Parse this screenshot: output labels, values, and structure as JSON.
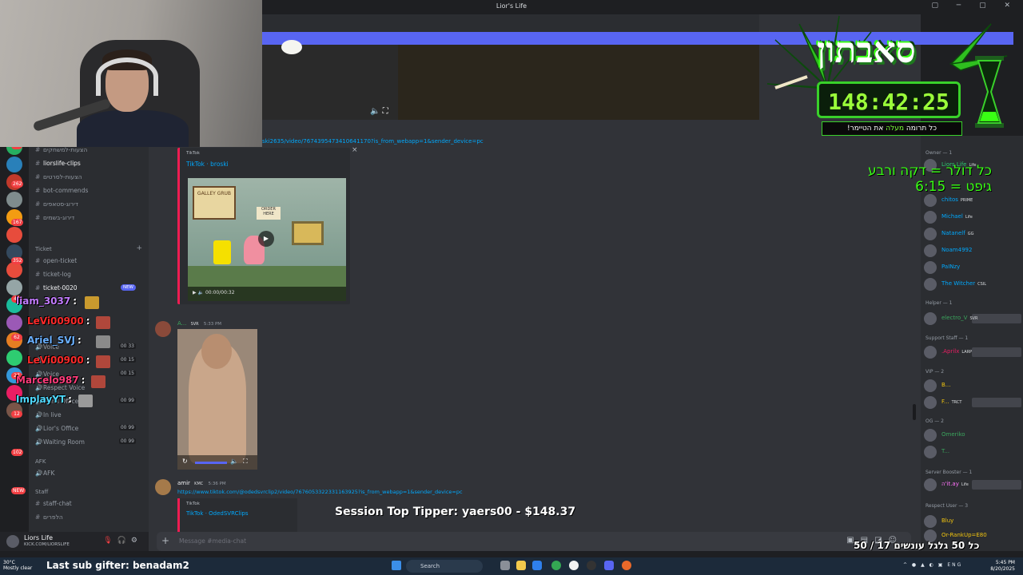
{
  "window": {
    "title": "Lior's Life"
  },
  "search": {
    "placeholder": "Search Lior's Life"
  },
  "channels": {
    "items": [
      {
        "name": "funny-clips",
        "active": true
      },
      {
        "name": "הצעות-למשחקים"
      },
      {
        "name": "liorslife-clips",
        "active": true
      },
      {
        "name": "הצעות-לסרטים"
      },
      {
        "name": "bot-commends"
      },
      {
        "name": "דירוג-סטאפים"
      },
      {
        "name": "דירוג-בשמים"
      }
    ],
    "ticket_category": "Ticket",
    "ticket_items": [
      {
        "name": "open-ticket"
      },
      {
        "name": "ticket-log"
      },
      {
        "name": "ticket-0020",
        "badge": "NEW"
      }
    ],
    "voice_items": [
      {
        "name": "Voice",
        "count": "00 33"
      },
      {
        "name": "Voice",
        "count": "00 15"
      },
      {
        "name": "Voice",
        "count": "00 15"
      },
      {
        "name": "Respect Voice",
        "count": ""
      },
      {
        "name": "Lior's Office",
        "count": "00 99"
      },
      {
        "name": "In live",
        "count": ""
      },
      {
        "name": "Lior's Office",
        "count": "00 99"
      },
      {
        "name": "Waiting Room",
        "count": "00 99"
      }
    ],
    "afk_category": "AFK",
    "afk_item": "AFK",
    "staff_category": "Staff",
    "staff_items": [
      {
        "name": "staff-chat"
      },
      {
        "name": "הלפרים"
      }
    ]
  },
  "rail_badges": [
    "2",
    "46",
    "389",
    "71",
    "262",
    "167",
    "352",
    "44",
    "62",
    "27",
    "12",
    "102",
    "NEW"
  ],
  "user": {
    "name": "Liors Life",
    "status": "KICK.COM/LIORSLIFE"
  },
  "messages": {
    "link1": "ski2635/video/7674395473410641170?is_from_webapp=1&sender_device=pc",
    "embed1": {
      "provider": "TikTok",
      "title": "TikTok · broski",
      "sign": "GALLEY GRUB",
      "order": "ORDER HERE",
      "time": "00:00/00:32"
    },
    "msg2": {
      "author": "A...",
      "tag": "SVR",
      "time": "5:33 PM"
    },
    "msg3": {
      "author": "amir",
      "tag": "KMC",
      "time": "5:36 PM",
      "link": "https://www.tiktok.com/@odedsvrclip2/video/7676053322331163925?is_from_webapp=1&sender_device=pc"
    },
    "embed2": {
      "provider": "TikTok",
      "title": "TikTok · OdedSVRClips"
    }
  },
  "composer": {
    "placeholder": "Message #media-chat"
  },
  "members": {
    "owner_cat": "Owner — 1",
    "owner": [
      {
        "name": "Liors Life",
        "tag": "Life",
        "color": "#2dc770"
      }
    ],
    "mod_list": [
      {
        "name": "chitos",
        "tag": "PRIME",
        "color": "#00a8fc"
      },
      {
        "name": "Michael",
        "tag": "Life",
        "color": "#00a8fc"
      },
      {
        "name": "Natanelf",
        "tag": "GG",
        "color": "#00a8fc"
      },
      {
        "name": "Noam4992",
        "tag": "",
        "color": "#00a8fc"
      },
      {
        "name": "PaINzy",
        "tag": "",
        "color": "#00a8fc"
      },
      {
        "name": "The Witcher",
        "tag": "CSIL",
        "color": "#00a8fc"
      }
    ],
    "helper_cat": "Helper — 1",
    "helper": [
      {
        "name": "electro_V",
        "tag": "SVR",
        "color": "#3ba55d"
      }
    ],
    "support_cat": "Support Staff — 1",
    "support": [
      {
        "name": ".Aprilx",
        "tag": "LARP",
        "color": "#e91e63"
      }
    ],
    "vip_cat": "VIP — 2",
    "vip": [
      {
        "name": "B...",
        "tag": "",
        "color": "#f1c40f"
      },
      {
        "name": "F...",
        "tag": "TRCT",
        "color": "#f1c40f"
      }
    ],
    "og_cat": "OG — 2",
    "og": [
      {
        "name": "Omeriko",
        "tag": "",
        "color": "#3ba55d"
      },
      {
        "name": "T...",
        "tag": "",
        "color": "#3ba55d"
      }
    ],
    "booster_cat": "Server Booster — 1",
    "booster": [
      {
        "name": "ה'it.ay",
        "tag": "Life",
        "color": "#ff73fa"
      }
    ],
    "respect_cat": "Respect User — 3",
    "respect": [
      {
        "name": "Bluy",
        "tag": "",
        "color": "#f1c40f"
      },
      {
        "name": "Or-RankUp=E80",
        "tag": "",
        "color": "#f1c40f"
      }
    ]
  },
  "overlay_chat": [
    {
      "name": "liam_3037",
      "color": "#c27bff"
    },
    {
      "name": "LeVi00900",
      "color": "#ff2a2a"
    },
    {
      "name": "Ariel_SVJ",
      "color": "#6ab0ff"
    },
    {
      "name": "LeVi00900",
      "color": "#ff2a2a"
    },
    {
      "name": "Marcelo987",
      "color": "#ff3b7a"
    },
    {
      "name": "ImplayYT",
      "color": "#4fd9ff"
    }
  ],
  "subathon": {
    "title": "סאבתון",
    "timer": "148:42:25",
    "note_a": "כל תרומה ",
    "note_hl": "מעלה",
    "note_b": " את הטיימר!"
  },
  "rule_lines": [
    "כל דולר = דקה ורבע",
    "גיפט = 6:15"
  ],
  "top_tipper": "Session Top Tipper: yaers00 - $148.37",
  "sub_goal": "כל 50 גלגל עונשים 17 / 50",
  "taskbar": {
    "temp": "30°C",
    "weather": "Mostly clear",
    "last_sub": "Last sub gifter: benadam2",
    "search": "Search",
    "lang": "ENG",
    "time": "5:45 PM",
    "date": "8/20/2025"
  },
  "colors": {
    "accent": "#5865f2",
    "tiktok": "#ee1d52",
    "link": "#00a8fc",
    "subathon_green": "#39ff14"
  }
}
